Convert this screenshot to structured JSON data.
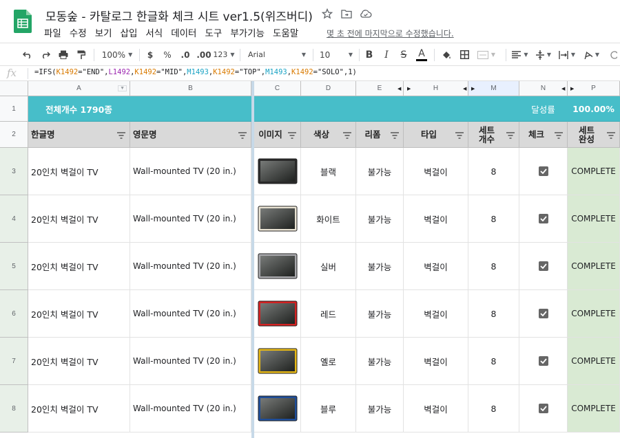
{
  "header": {
    "title": "모동숲 - 카탈로그 한글화 체크 시트 ver1.5(위즈버디)",
    "menu": [
      "파일",
      "수정",
      "보기",
      "삽입",
      "서식",
      "데이터",
      "도구",
      "부가기능",
      "도움말"
    ],
    "last_edit": "몇 초 전에 마지막으로 수정했습니다."
  },
  "toolbar": {
    "zoom": "100%",
    "currency": "$",
    "percent": "%",
    "dec_decrease": ".0",
    "dec_increase": ".00",
    "format_more": "123",
    "font": "Arial",
    "font_size": "10",
    "bold": "B",
    "italic": "I",
    "strike": "S",
    "text_color": "A"
  },
  "formula_bar": {
    "fx": "fx",
    "formula": "=IFS(K1492=\"END\",L1492,K1492=\"MID\",M1493,K1492=\"TOP\",M1493,K1492=\"SOLO\",1)",
    "parts": [
      {
        "t": "=IFS(",
        "c": ""
      },
      {
        "t": "K1492",
        "c": "k"
      },
      {
        "t": "=\"END\",",
        "c": ""
      },
      {
        "t": "L1492",
        "c": "l"
      },
      {
        "t": ",",
        "c": ""
      },
      {
        "t": "K1492",
        "c": "k"
      },
      {
        "t": "=\"MID\",",
        "c": ""
      },
      {
        "t": "M1493",
        "c": "m"
      },
      {
        "t": ",",
        "c": ""
      },
      {
        "t": "K1492",
        "c": "k"
      },
      {
        "t": "=\"TOP\",",
        "c": ""
      },
      {
        "t": "M1493",
        "c": "m"
      },
      {
        "t": ",",
        "c": ""
      },
      {
        "t": "K1492",
        "c": "k"
      },
      {
        "t": "=\"SOLO\",1)",
        "c": ""
      }
    ]
  },
  "columns": [
    "A",
    "B",
    "C",
    "D",
    "E",
    "H",
    "M",
    "N",
    "P"
  ],
  "row_numbers": [
    "1",
    "2",
    "3",
    "4",
    "5",
    "6",
    "7",
    "8"
  ],
  "summary": {
    "total": "전체개수 1790종",
    "rate_label": "달성률",
    "rate_value": "100.00%"
  },
  "table_headers": [
    "한글명",
    "영문명",
    "이미지",
    "색상",
    "리폼",
    "타입",
    "세트개수",
    "체크",
    "세트완성"
  ],
  "rows": [
    {
      "name_ko": "20인치 벽걸이 TV",
      "name_en": "Wall-mounted TV (20 in.)",
      "image": "tv-black",
      "color": "블랙",
      "reform": "불가능",
      "type": "벽걸이",
      "set_count": "8",
      "checked": true,
      "set_complete": "COMPLETE"
    },
    {
      "name_ko": "20인치 벽걸이 TV",
      "name_en": "Wall-mounted TV (20 in.)",
      "image": "tv-white",
      "color": "화이트",
      "reform": "불가능",
      "type": "벽걸이",
      "set_count": "8",
      "checked": true,
      "set_complete": "COMPLETE"
    },
    {
      "name_ko": "20인치 벽걸이 TV",
      "name_en": "Wall-mounted TV (20 in.)",
      "image": "tv-silver",
      "color": "실버",
      "reform": "불가능",
      "type": "벽걸이",
      "set_count": "8",
      "checked": true,
      "set_complete": "COMPLETE"
    },
    {
      "name_ko": "20인치 벽걸이 TV",
      "name_en": "Wall-mounted TV (20 in.)",
      "image": "tv-red",
      "color": "레드",
      "reform": "불가능",
      "type": "벽걸이",
      "set_count": "8",
      "checked": true,
      "set_complete": "COMPLETE"
    },
    {
      "name_ko": "20인치 벽걸이 TV",
      "name_en": "Wall-mounted TV (20 in.)",
      "image": "tv-yellow",
      "color": "옐로",
      "reform": "불가능",
      "type": "벽걸이",
      "set_count": "8",
      "checked": true,
      "set_complete": "COMPLETE"
    },
    {
      "name_ko": "20인치 벽걸이 TV",
      "name_en": "Wall-mounted TV (20 in.)",
      "image": "tv-blue",
      "color": "블루",
      "reform": "불가능",
      "type": "벽걸이",
      "set_count": "8",
      "checked": true,
      "set_complete": "COMPLETE"
    }
  ],
  "tv_colors": {
    "tv-black": "#2a2a2a",
    "tv-white": "#e9e3d3",
    "tv-silver": "#a9a9ad",
    "tv-red": "#d32323",
    "tv-yellow": "#e6b817",
    "tv-blue": "#1f4e9a"
  },
  "colors": {
    "teal": "#47bec9",
    "header_gray": "#d9d9d9",
    "complete_green": "#d9ead3",
    "sheets_green": "#23a566"
  }
}
